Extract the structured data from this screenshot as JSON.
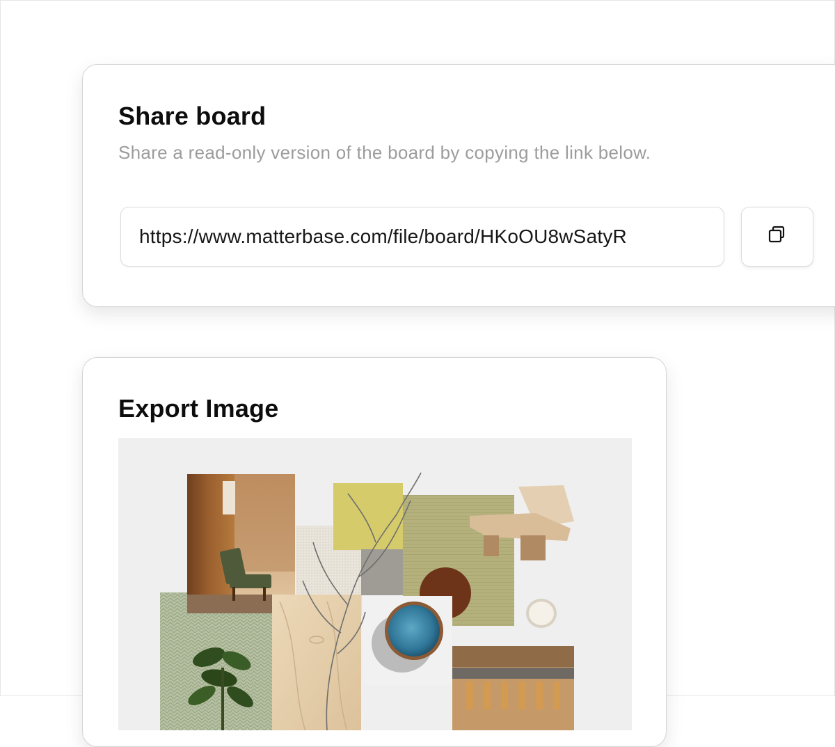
{
  "share": {
    "title": "Share board",
    "description": "Share a read-only version of the board by copying the link below.",
    "link": "https://www.matterbase.com/file/board/HKoOU8wSatyR",
    "copy_icon": "copy-icon"
  },
  "export": {
    "title": "Export Image",
    "preview_items": [
      "interior-room-photo",
      "wood-veneer-swatch",
      "white-textile-swatch",
      "yellow-fabric-swatch",
      "olive-fabric-swatch",
      "lounge-chair-photo",
      "grey-fabric-swatch",
      "green-herringbone-swatch",
      "light-wood-swatch",
      "blue-ceramic-bowl-photo",
      "brown-circle-swatch",
      "white-dish-photo",
      "restaurant-interior-photo",
      "plant-photo",
      "dried-branch"
    ]
  },
  "colors": {
    "title": "#0d0d0d",
    "description": "#9c9c9c",
    "border": "#d4d4d4",
    "preview_background": "#efefef"
  }
}
